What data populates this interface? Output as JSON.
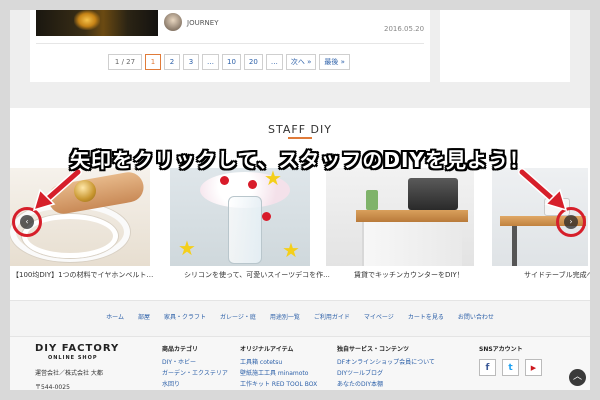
{
  "post": {
    "author": "JOURNEY",
    "date": "2016.05.20"
  },
  "pagination": {
    "info": "1 / 27",
    "pages": [
      "1",
      "2",
      "3",
      "…",
      "10",
      "20",
      "…"
    ],
    "next": "次へ »",
    "last": "最後 »"
  },
  "staff": {
    "title": "STAFF DIY",
    "banner": "矢印をクリックして、スタッフのDIYを見よう！",
    "slides": [
      {
        "caption": "【100均DIY】1つの材料でイヤホンベルト…"
      },
      {
        "caption": "シリコンを使って、可愛いスイーツデコを作..."
      },
      {
        "caption": "賃貸でキッチンカウンターをDIY！"
      },
      {
        "caption": "サイドテーブル完成へ"
      }
    ],
    "prev_arrow": "‹",
    "next_arrow": "›"
  },
  "footer_nav": [
    "ホーム",
    "部屋",
    "家具・クラフト",
    "ガレージ・庭",
    "用途別一覧",
    "ご利用ガイド",
    "マイページ",
    "カートを見る",
    "お問い合わせ"
  ],
  "footer": {
    "logo": "DIY FACTORY",
    "logo_sub": "ONLINE SHOP",
    "company": "運営会社／株式会社 大都",
    "postal": "〒544-0025",
    "columns": [
      {
        "heading": "商品カテゴリ",
        "links": [
          "DIY・ホビー",
          "ガーデン・エクステリア",
          "水回り"
        ]
      },
      {
        "heading": "オリジナルアイテム",
        "links": [
          "工具箱 cotetsu",
          "壁紙施工工具 minamoto",
          "工作キット RED TOOL BOX"
        ]
      },
      {
        "heading": "独自サービス・コンテンツ",
        "links": [
          "DFオンラインショップ会員について",
          "DIYツールブログ",
          "あなたのDIY本棚"
        ]
      }
    ],
    "sns_title": "SNSアカウント",
    "sns": [
      {
        "label": "f",
        "color": "#3b5998"
      },
      {
        "label": "t",
        "color": "#1da1f2"
      },
      {
        "label": "▶",
        "color": "#cc181e"
      }
    ],
    "to_top": "︿"
  },
  "colors": {
    "accent": "#e07b39",
    "link": "#2b5fa8",
    "annotation_red": "#d61f2a"
  }
}
